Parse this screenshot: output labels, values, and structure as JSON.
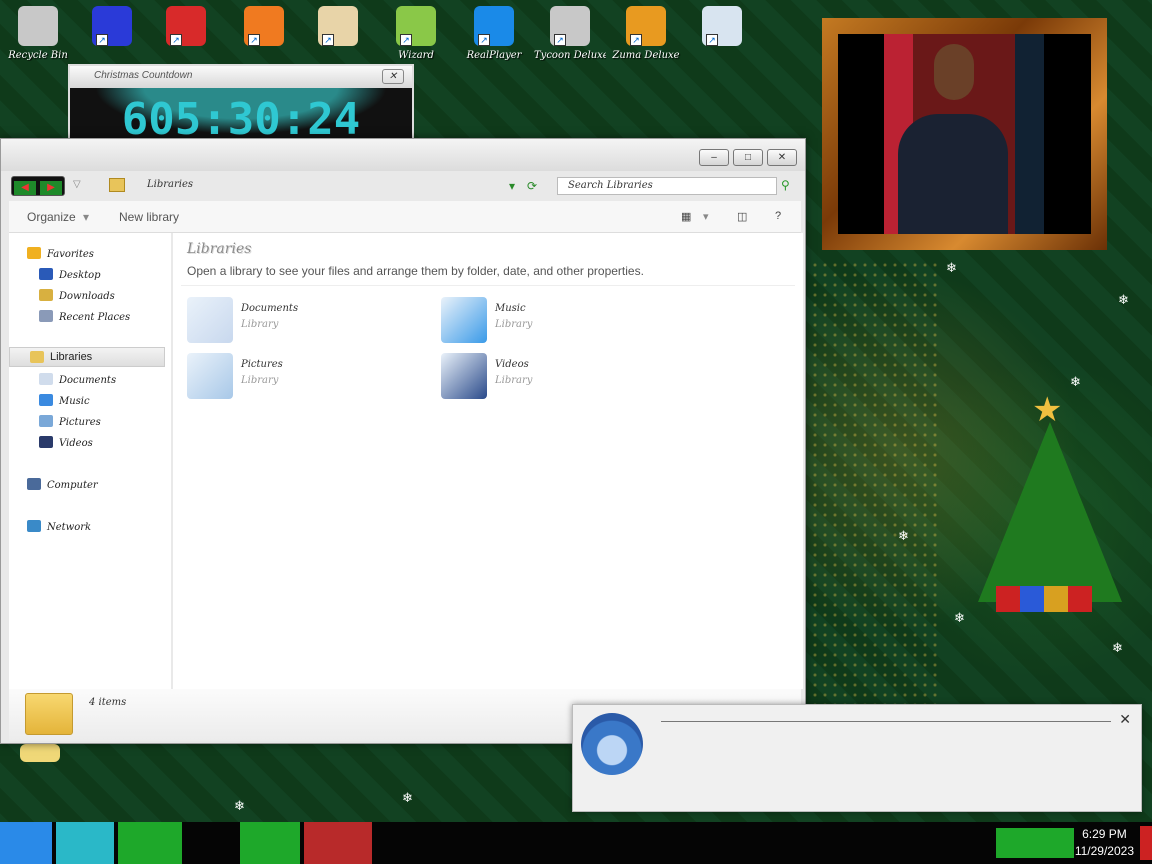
{
  "desktop": {
    "icons": [
      {
        "label": "Recycle Bin",
        "color": "#c8c8c8"
      },
      {
        "label": "",
        "color": "#2a3ad8"
      },
      {
        "label": "",
        "color": "#d82a2a"
      },
      {
        "label": "",
        "color": "#f07a20"
      },
      {
        "label": "",
        "color": "#e8d4a8"
      },
      {
        "label": "Wizard",
        "color": "#8ac848"
      },
      {
        "label": "RealPlayer",
        "color": "#1a8ae8"
      },
      {
        "label": "Tycoon Deluxe",
        "color": "#c8c8c8"
      },
      {
        "label": "Zuma Deluxe",
        "color": "#e89a20"
      },
      {
        "label": "",
        "color": "#d8e4f0"
      }
    ],
    "bottom_icon_label": "",
    "snowflake": "❄"
  },
  "countdown": {
    "title": "Christmas Countdown",
    "value": "605:30:24",
    "close": "✕"
  },
  "explorer": {
    "title_buttons": {
      "minimize": "–",
      "maximize": "□",
      "close": "✕"
    },
    "nav": {
      "back": "◀",
      "forward": "▶",
      "dropdown": "▽"
    },
    "address": "Libraries",
    "search_placeholder": "Search Libraries",
    "search_icon": "⚲",
    "refresh_icon": "⟳",
    "address_dropdown": "▾",
    "toolbar": {
      "organize": "Organize",
      "organize_arrow": "▾",
      "new_library": "New library",
      "views_icon": "▦",
      "views_arrow": "▾",
      "preview_icon": "◫",
      "help": "?"
    },
    "sidebar": {
      "favorites": "Favorites",
      "favorites_items": [
        "Desktop",
        "Downloads",
        "Recent Places"
      ],
      "libraries": "Libraries",
      "libraries_items": [
        "Documents",
        "Music",
        "Pictures",
        "Videos"
      ],
      "computer": "Computer",
      "network": "Network"
    },
    "content": {
      "heading": "Libraries",
      "description": "Open a library to see your files and arrange them by folder, date, and other properties.",
      "items": [
        {
          "name": "Documents",
          "type": "Library",
          "color": "#c8d8ee"
        },
        {
          "name": "Music",
          "type": "Library",
          "color": "#3a9ae8"
        },
        {
          "name": "Pictures",
          "type": "Library",
          "color": "#a8c8e8"
        },
        {
          "name": "Videos",
          "type": "Library",
          "color": "#2a4a8a"
        }
      ]
    },
    "details": "4 items"
  },
  "notification": {
    "from": "",
    "subject": "",
    "sender": "",
    "body": "",
    "close": "✕"
  },
  "taskbar": {
    "time": "6:29 PM",
    "date": "11/29/2023",
    "apps": [
      {
        "name": "santa",
        "color": "#2a8ae8"
      },
      {
        "name": "firefox",
        "color": "#2ab8c8"
      },
      {
        "name": "explorer",
        "color": "#1ea82a"
      },
      {
        "name": "chrome",
        "color": "#050505"
      },
      {
        "name": "tree",
        "color": "#1ea82a"
      },
      {
        "name": "window",
        "color": "#b82a2a"
      }
    ]
  }
}
